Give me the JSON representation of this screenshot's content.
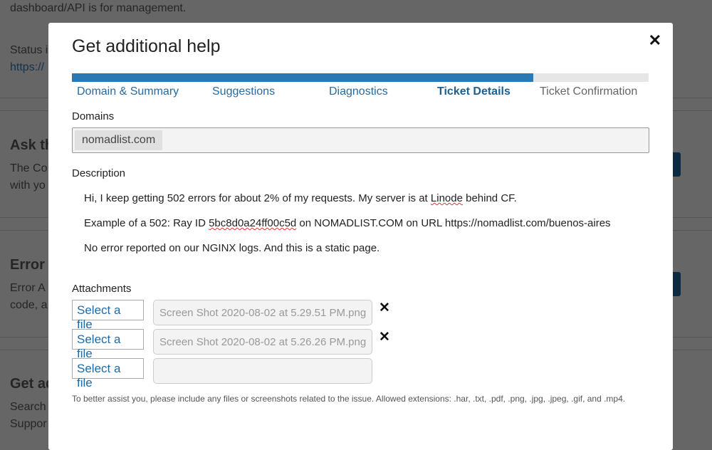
{
  "background": {
    "line1": "dashboard/API is for management.",
    "status": "Status i",
    "status_link": "https://",
    "ask_heading": "Ask th",
    "ask_text1": "The Co",
    "ask_text2": "with yo",
    "error_heading": "Error A",
    "error_text1": "Error A",
    "error_text2": "code, a",
    "get_heading": "Get ad",
    "get_text1": "Search",
    "get_text2": "Suppor"
  },
  "modal": {
    "title": "Get additional help",
    "close_icon": "close-icon",
    "progress_percent": 80,
    "steps": [
      "Domain & Summary",
      "Suggestions",
      "Diagnostics",
      "Ticket Details",
      "Ticket Confirmation"
    ],
    "active_step": "Ticket Details",
    "domains_label": "Domains",
    "domain_chip": "nomadlist.com",
    "description_label": "Description",
    "description": {
      "line1_a": "Hi, I keep getting 502 errors for about 2% of my requests. My server is at ",
      "line1_b": "Linode",
      "line1_c": " behind CF.",
      "line2_a": "Example of a 502: Ray ID ",
      "line2_b": "5bc8d0a24ff00c5d",
      "line2_c": " on NOMADLIST.COM on URL https://nomadlist.com/buenos-aires",
      "line3": "No error reported on our NGINX logs. And this is a static page."
    },
    "attachments_label": "Attachments",
    "attachments": [
      {
        "button": "Select a file",
        "filename": "Screen Shot 2020-08-02 at 5.29.51 PM.png",
        "remove": "✕"
      },
      {
        "button": "Select a file",
        "filename": "Screen Shot 2020-08-02 at 5.26.26 PM.png",
        "remove": "✕"
      },
      {
        "button": "Select a file",
        "filename": ""
      }
    ],
    "help_text": "To better assist you, please include any files or screenshots related to the issue.  Allowed extensions: .har, .txt, .pdf, .png, .jpg, .jpeg, .gif, and .mp4."
  }
}
